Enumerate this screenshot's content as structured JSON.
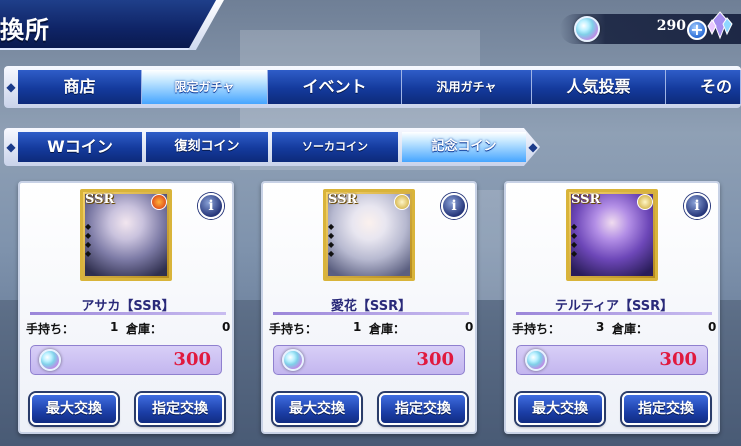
{
  "header": {
    "title": "換所",
    "currency": {
      "value": "290",
      "plus": "+",
      "icon": "gem-icon"
    }
  },
  "main_tabs": [
    {
      "label": "商店"
    },
    {
      "label": "限定ガチャ"
    },
    {
      "label": "イベント"
    },
    {
      "label": "汎用ガチャ"
    },
    {
      "label": "人気投票"
    },
    {
      "label": "その他"
    }
  ],
  "coin_tabs": [
    {
      "label": "Wコイン"
    },
    {
      "label": "復刻コイン"
    },
    {
      "label": "ソーカコイン"
    },
    {
      "label": "記念コイン"
    }
  ],
  "cards": [
    {
      "rarity": "SSR",
      "name": "アサカ【SSR】",
      "element": "fire",
      "hold_label": "手持ち：",
      "hold": "1",
      "warehouse_label": "倉庫：",
      "warehouse": "0",
      "price": "300",
      "max_label": "最大交換",
      "spec_label": "指定交換",
      "info": "i"
    },
    {
      "rarity": "SSR",
      "name": "愛花【SSR】",
      "element": "light",
      "hold_label": "手持ち：",
      "hold": "1",
      "warehouse_label": "倉庫：",
      "warehouse": "0",
      "price": "300",
      "max_label": "最大交換",
      "spec_label": "指定交換",
      "info": "i"
    },
    {
      "rarity": "SSR",
      "name": "テルティア【SSR】",
      "element": "light",
      "hold_label": "手持ち：",
      "hold": "3",
      "warehouse_label": "倉庫：",
      "warehouse": "0",
      "price": "300",
      "max_label": "最大交換",
      "spec_label": "指定交換",
      "info": "i"
    }
  ],
  "colors": {
    "accent_blue": "#143a9c",
    "price_red": "#e0193e",
    "gold": "#d9b43a"
  }
}
